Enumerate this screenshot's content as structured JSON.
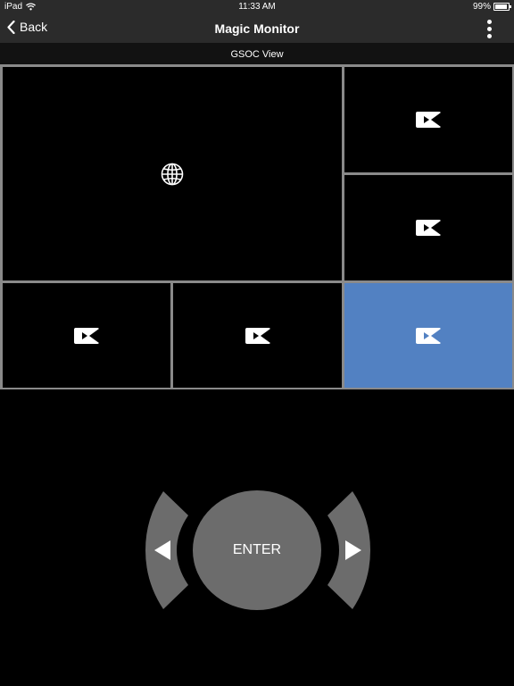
{
  "status_bar": {
    "device": "iPad",
    "time": "11:33 AM",
    "battery": "99%"
  },
  "nav": {
    "back_label": "Back",
    "title": "Magic Monitor",
    "menu_icon": "more-vertical-icon"
  },
  "view": {
    "label": "GSOC View"
  },
  "tiles": [
    {
      "id": "main",
      "icon": "globe-icon",
      "selected": false
    },
    {
      "id": "right-top",
      "icon": "video-camera-icon",
      "selected": false
    },
    {
      "id": "right-middle",
      "icon": "video-camera-icon",
      "selected": false
    },
    {
      "id": "bottom-left",
      "icon": "video-camera-icon",
      "selected": false
    },
    {
      "id": "bottom-middle",
      "icon": "video-camera-icon",
      "selected": false
    },
    {
      "id": "bottom-right",
      "icon": "video-camera-icon",
      "selected": true
    }
  ],
  "controls": {
    "enter_label": "ENTER",
    "prev_icon": "triangle-left-icon",
    "next_icon": "triangle-right-icon"
  },
  "colors": {
    "bar": "#2b2b2b",
    "selected_tile": "#5281c2",
    "button": "#6c6c6c",
    "grid_border": "#8a8a8a"
  }
}
